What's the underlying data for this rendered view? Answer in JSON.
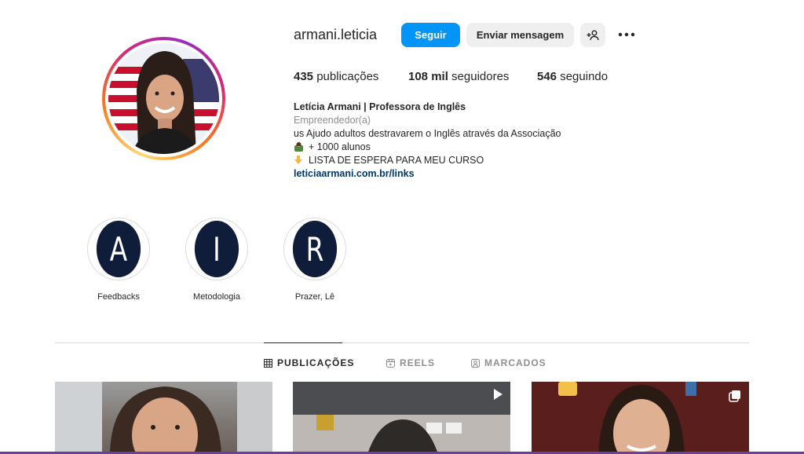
{
  "profile": {
    "username": "armani.leticia",
    "follow_label": "Seguir",
    "message_label": "Enviar mensagem"
  },
  "stats": {
    "posts_count": "435",
    "posts_label": "publicações",
    "followers_count": "108 mil",
    "followers_label": "seguidores",
    "following_count": "546",
    "following_label": "seguindo"
  },
  "bio": {
    "name": "Letícia Armani | Professora de Inglês",
    "category": "Empreendedor(a)",
    "line1": "us Ajudo adultos destravarem o Inglês através da Associação",
    "line2": "+ 1000 alunos",
    "line3": "LISTA DE ESPERA PARA MEU CURSO",
    "link": "leticiaarmani.com.br/links"
  },
  "highlights": [
    {
      "letter": "A",
      "label": "Feedbacks"
    },
    {
      "letter": "I",
      "label": "Metodologia"
    },
    {
      "letter": "R",
      "label": "Prazer, Lê"
    }
  ],
  "tabs": [
    {
      "label": "PUBLICAÇÕES",
      "icon": "grid-icon",
      "active": true
    },
    {
      "label": "REELS",
      "icon": "reels-icon",
      "active": false
    },
    {
      "label": "MARCADOS",
      "icon": "tagged-icon",
      "active": false
    }
  ],
  "colors": {
    "accent": "#0095f6",
    "highlight_bg": "#0f1d3a",
    "link": "#00376b"
  }
}
